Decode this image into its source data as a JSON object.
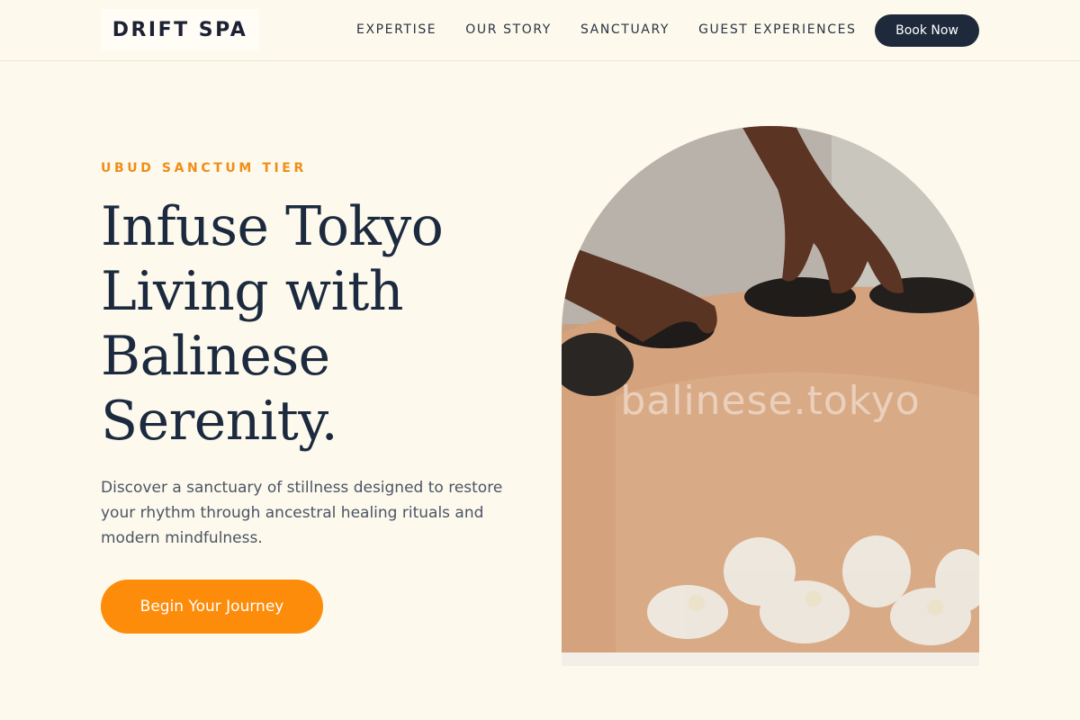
{
  "header": {
    "logo": "DRIFT SPA",
    "nav": [
      "EXPERTISE",
      "OUR STORY",
      "SANCTUARY",
      "GUEST EXPERIENCES"
    ],
    "book_label": "Book Now"
  },
  "hero": {
    "eyebrow": "UBUD SANCTUM TIER",
    "headline": "Infuse Tokyo Living with Balinese Serenity.",
    "description": "Discover a sanctuary of stillness designed to restore your rhythm through ancestral healing rituals and modern mindfulness.",
    "cta_label": "Begin Your Journey",
    "image_watermark": "balinese.tokyo"
  },
  "colors": {
    "background": "#fdf9ec",
    "accent": "#fd8c0b",
    "eyebrow": "#f18d16",
    "dark": "#1e293b"
  }
}
